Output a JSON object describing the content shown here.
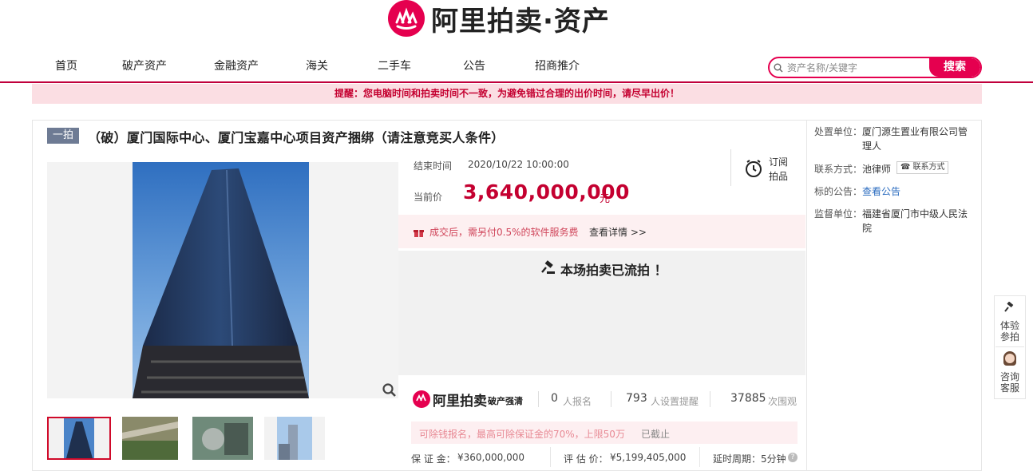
{
  "header": {
    "logo_text": "阿里拍卖·资产"
  },
  "nav": {
    "items": [
      "首页",
      "破产资产",
      "金融资产",
      "海关",
      "二手车",
      "公告",
      "招商推介"
    ]
  },
  "search": {
    "placeholder": "资产名称/关键字",
    "button_label": "搜索"
  },
  "notice": "提醒：您电脑时间和拍卖时间不一致，为避免错过合理的出价时间，请尽早出价！",
  "auction": {
    "round_tag": "一拍",
    "title": "（破）厦门国际中心、厦门宝嘉中心项目资产捆绑（请注意竞买人条件）",
    "end_time_label": "结束时间",
    "end_time": "2020/10/22 10:00:00",
    "current_price_label": "当前价",
    "current_price": "3,640,000,000",
    "currency": "元",
    "subscribe_label_1": "订阅",
    "subscribe_label_2": "拍品",
    "fee_notice": "成交后，需另付0.5%的软件服务费",
    "fee_link": "查看详情 >>",
    "status": "本场拍卖已流拍 ！",
    "brand_text": "阿里拍卖",
    "brand_sub": "破产强清",
    "registrations_count": "0",
    "registrations_label": "人报名",
    "reminders_count": "793",
    "reminders_label": "人设置提醒",
    "views_count": "37885",
    "views_label": "次围观",
    "margin_notice": "可除钱报名，最高可除保证金的70%，上限50万",
    "margin_status": "已截止",
    "deposit_label": "保 证 金：",
    "deposit_value": "¥360,000,000",
    "appraisal_label": "评 估 价：",
    "appraisal_value": "¥5,199,405,000",
    "delay_label": "延时周期：",
    "delay_value": "5分钟"
  },
  "side": {
    "handler_label": "处置单位：",
    "handler_value": "厦门源生置业有限公司管理人",
    "contact_label": "联系方式：",
    "contact_name": "池律师",
    "contact_button": "联系方式",
    "notice_label": "标的公告：",
    "notice_link": "查看公告",
    "supervisor_label": "监督单位：",
    "supervisor_value": "福建省厦门市中级人民法院"
  },
  "floater": {
    "item1": "体验参拍",
    "item2": "咨询客服"
  },
  "colors": {
    "brand": "#e5004f",
    "price": "#c40030",
    "tag": "#6e7b94"
  }
}
